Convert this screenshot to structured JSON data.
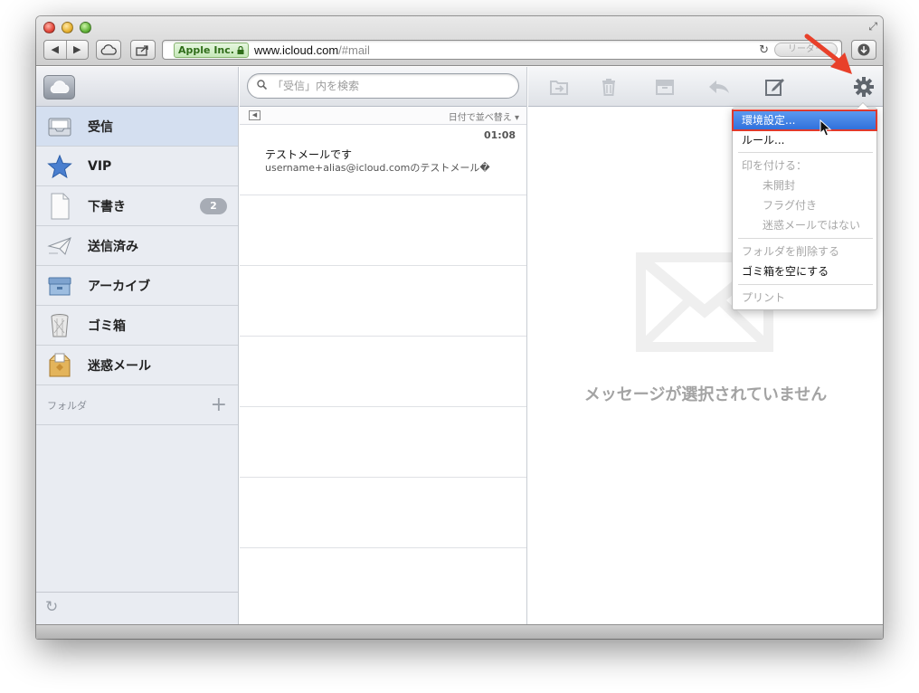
{
  "browser": {
    "url_host": "www.icloud.com",
    "url_path": "/#mail",
    "cert_label": "Apple Inc.",
    "reader_label": "リーダー"
  },
  "search": {
    "placeholder": "「受信」内を検索"
  },
  "sidebar": {
    "mailboxes": [
      {
        "label": "受信",
        "icon": "inbox-icon"
      },
      {
        "label": "VIP",
        "icon": "star-icon"
      },
      {
        "label": "下書き",
        "icon": "draft-document-icon",
        "badge": "2"
      },
      {
        "label": "送信済み",
        "icon": "sent-paper-plane-icon"
      },
      {
        "label": "アーカイブ",
        "icon": "archive-box-icon"
      },
      {
        "label": "ゴミ箱",
        "icon": "trash-can-icon"
      },
      {
        "label": "迷惑メール",
        "icon": "junk-box-icon"
      }
    ],
    "folders_label": "フォルダ"
  },
  "list": {
    "sort_label": "日付で並べ替え",
    "messages": [
      {
        "time": "01:08",
        "subject": "テストメールです",
        "preview": "username+alias@icloud.comのテストメール�"
      }
    ]
  },
  "viewer": {
    "empty_text": "メッセージが選択されていません"
  },
  "menu": {
    "preferences": "環境設定...",
    "rules": "ルール...",
    "mark_as": "印を付ける：",
    "unread": "未開封",
    "flagged": "フラグ付き",
    "not_junk": "迷惑メールではない",
    "delete_folder": "フォルダを削除する",
    "empty_trash": "ゴミ箱を空にする",
    "print": "プリント"
  },
  "colors": {
    "accent": "#2f6fdb",
    "highlight_outline": "#e03a2c",
    "annotation_arrow": "#e8402a"
  }
}
